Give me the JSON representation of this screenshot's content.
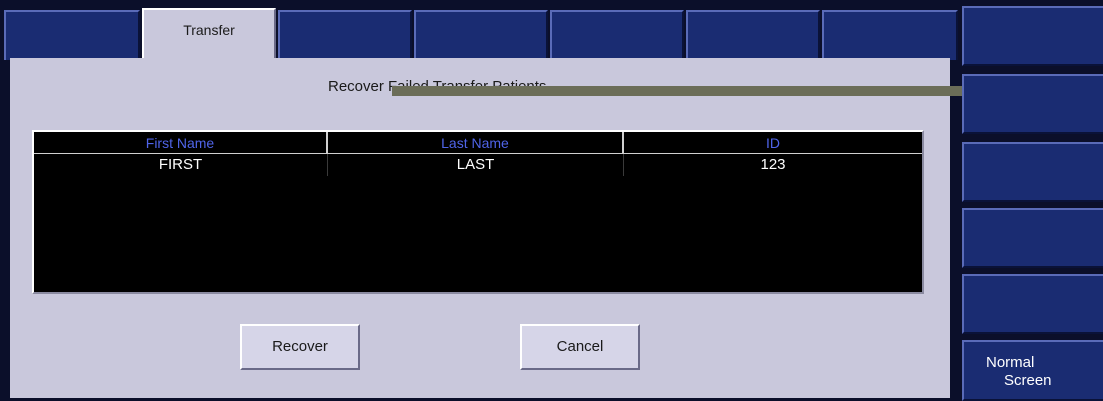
{
  "tabs": [
    {
      "label": ""
    },
    {
      "label": "Transfer"
    },
    {
      "label": ""
    },
    {
      "label": ""
    },
    {
      "label": ""
    },
    {
      "label": ""
    },
    {
      "label": ""
    }
  ],
  "dialog": {
    "heading": "Recover Failed Transfer Patients..."
  },
  "table": {
    "columns": [
      "First Name",
      "Last Name",
      "ID"
    ],
    "rows": [
      {
        "first": "FIRST",
        "last": "LAST",
        "id": "123"
      }
    ]
  },
  "buttons": {
    "recover": "Recover",
    "cancel": "Cancel"
  },
  "side_panel": {
    "mode_line1": "Normal",
    "mode_line2": "Screen"
  },
  "colors": {
    "panel_bg": "#c9c8dc",
    "tab_bg": "#1a2c72",
    "header_text": "#4f64e8"
  }
}
